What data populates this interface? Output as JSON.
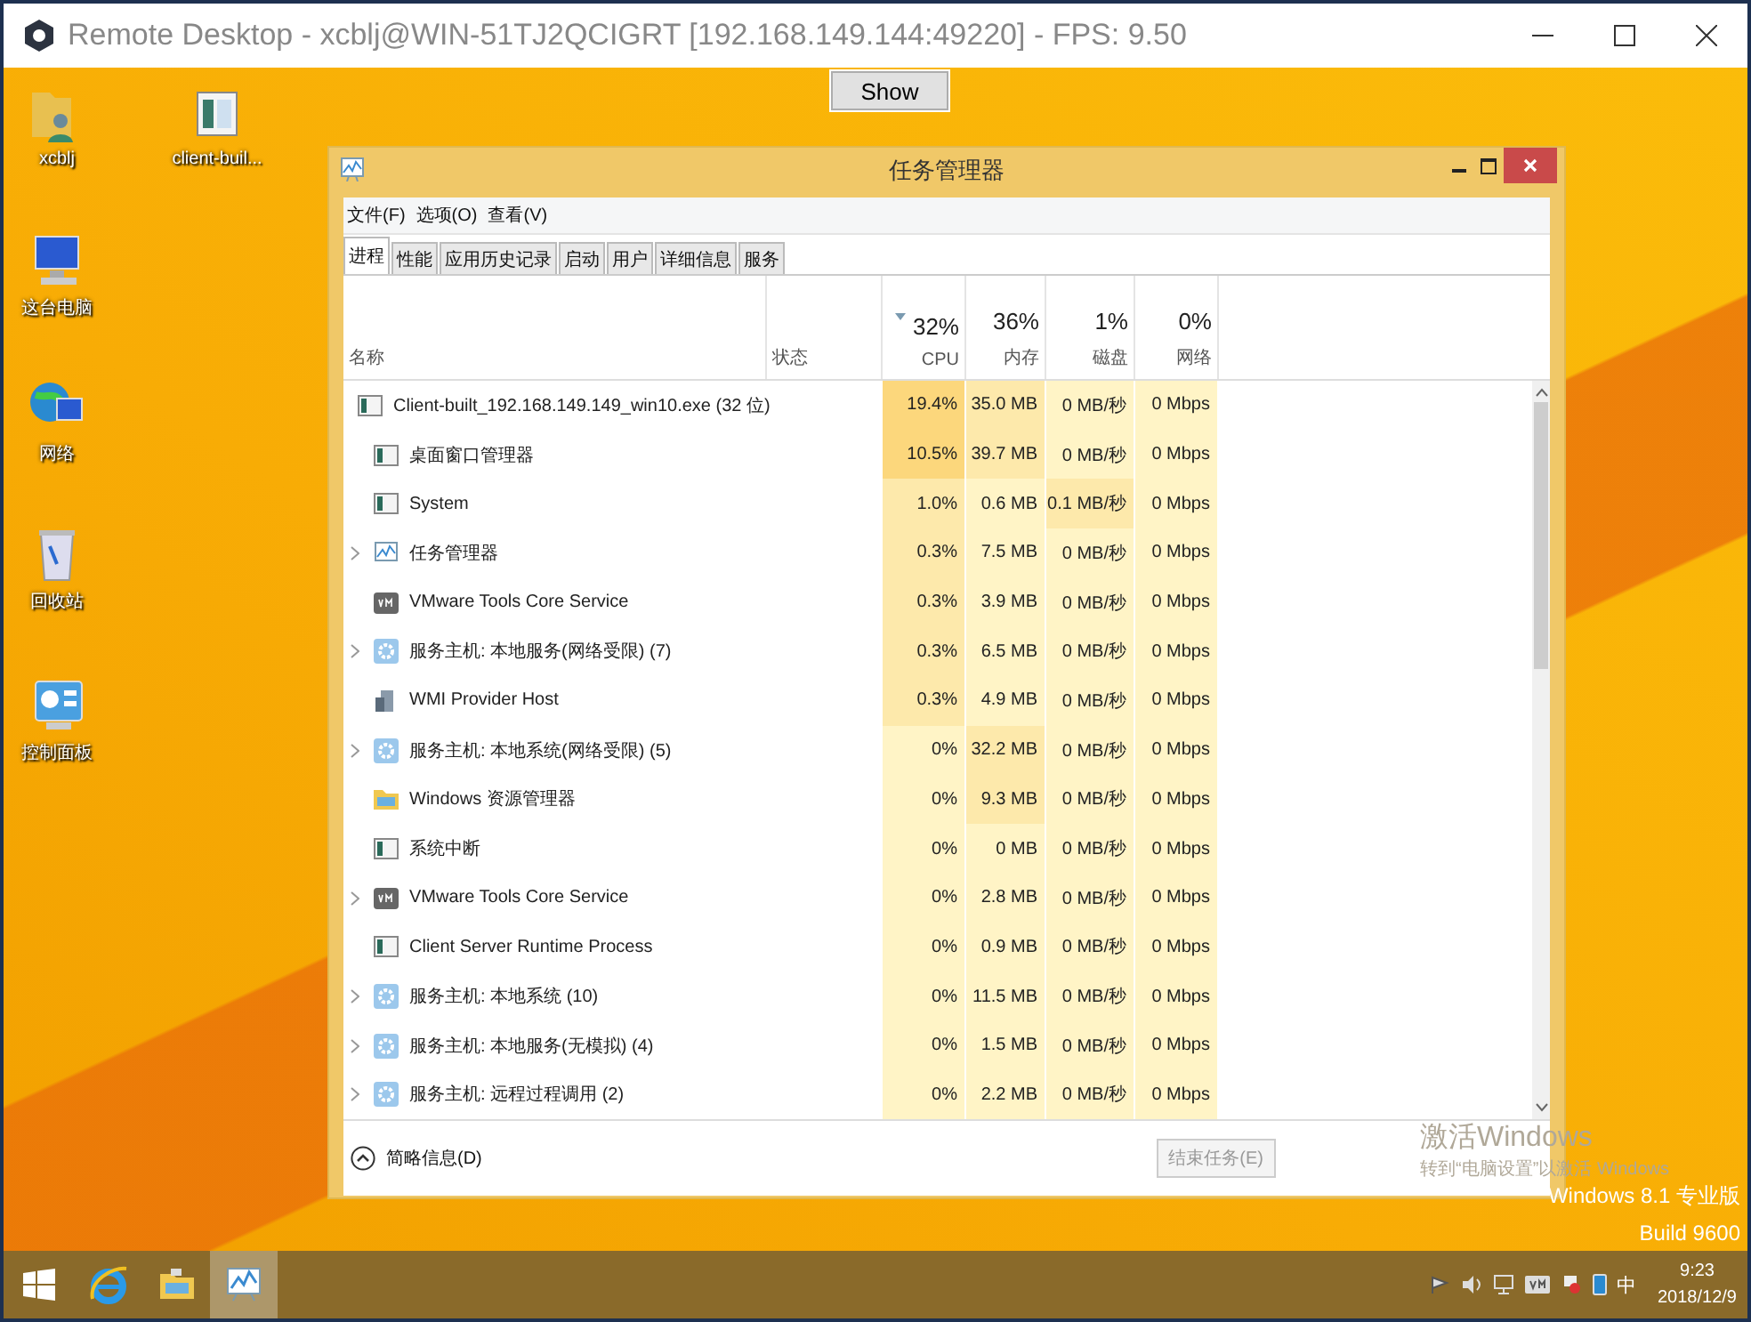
{
  "window": {
    "title": "Remote Desktop - xcblj@WIN-51TJ2QCIGRT [192.168.149.144:49220] - FPS: 9.50"
  },
  "show_button": "Show",
  "desktop_icons": [
    {
      "label": "xcblj",
      "kind": "userfolder"
    },
    {
      "label": "client-buil...",
      "kind": "app"
    },
    {
      "label": "这台电脑",
      "kind": "computer"
    },
    {
      "label": "网络",
      "kind": "network"
    },
    {
      "label": "回收站",
      "kind": "bin"
    },
    {
      "label": "控制面板",
      "kind": "panel"
    }
  ],
  "task_manager": {
    "title": "任务管理器",
    "menu": [
      "文件(F)",
      "选项(O)",
      "查看(V)"
    ],
    "tabs": [
      {
        "label": "进程",
        "selected": true
      },
      {
        "label": "性能",
        "selected": false
      },
      {
        "label": "应用历史记录",
        "selected": false
      },
      {
        "label": "启动",
        "selected": false
      },
      {
        "label": "用户",
        "selected": false
      },
      {
        "label": "详细信息",
        "selected": false
      },
      {
        "label": "服务",
        "selected": false
      }
    ],
    "columns": [
      {
        "label": "名称",
        "kind": "text"
      },
      {
        "label": "状态",
        "kind": "text"
      },
      {
        "label": "CPU",
        "percent": "32%",
        "kind": "metric",
        "sorted": true
      },
      {
        "label": "内存",
        "percent": "36%",
        "kind": "metric",
        "sorted": false
      },
      {
        "label": "磁盘",
        "percent": "1%",
        "kind": "metric",
        "sorted": false
      },
      {
        "label": "网络",
        "percent": "0%",
        "kind": "metric",
        "sorted": false
      }
    ],
    "rows": [
      {
        "kind": "app",
        "expandable": false,
        "cells": [
          {
            "text": "Client-built_192.168.149.149_win10.exe (32 位)"
          },
          {
            "text": ""
          },
          {
            "text": "19.4%",
            "kind": "hot"
          },
          {
            "text": "35.0 MB",
            "kind": "warm"
          },
          {
            "text": "0 MB/秒",
            "kind": "cool"
          },
          {
            "text": "0 Mbps",
            "kind": "cool"
          }
        ]
      },
      {
        "kind": "app",
        "expandable": false,
        "cells": [
          {
            "text": "桌面窗口管理器"
          },
          {
            "text": ""
          },
          {
            "text": "10.5%",
            "kind": "hot"
          },
          {
            "text": "39.7 MB",
            "kind": "warm"
          },
          {
            "text": "0 MB/秒",
            "kind": "cool"
          },
          {
            "text": "0 Mbps",
            "kind": "cool"
          }
        ]
      },
      {
        "kind": "app",
        "expandable": false,
        "cells": [
          {
            "text": "System"
          },
          {
            "text": ""
          },
          {
            "text": "1.0%",
            "kind": "warm"
          },
          {
            "text": "0.6 MB",
            "kind": "cool"
          },
          {
            "text": "0.1 MB/秒",
            "kind": "warm"
          },
          {
            "text": "0 Mbps",
            "kind": "cool"
          }
        ]
      },
      {
        "kind": "chart",
        "expandable": true,
        "cells": [
          {
            "text": "任务管理器"
          },
          {
            "text": ""
          },
          {
            "text": "0.3%",
            "kind": "warm"
          },
          {
            "text": "7.5 MB",
            "kind": "cool"
          },
          {
            "text": "0 MB/秒",
            "kind": "cool"
          },
          {
            "text": "0 Mbps",
            "kind": "cool"
          }
        ]
      },
      {
        "kind": "vm",
        "expandable": false,
        "cells": [
          {
            "text": "VMware Tools Core Service"
          },
          {
            "text": ""
          },
          {
            "text": "0.3%",
            "kind": "warm"
          },
          {
            "text": "3.9 MB",
            "kind": "cool"
          },
          {
            "text": "0 MB/秒",
            "kind": "cool"
          },
          {
            "text": "0 Mbps",
            "kind": "cool"
          }
        ]
      },
      {
        "kind": "gear",
        "expandable": true,
        "cells": [
          {
            "text": "服务主机: 本地服务(网络受限) (7)"
          },
          {
            "text": ""
          },
          {
            "text": "0.3%",
            "kind": "warm"
          },
          {
            "text": "6.5 MB",
            "kind": "cool"
          },
          {
            "text": "0 MB/秒",
            "kind": "cool"
          },
          {
            "text": "0 Mbps",
            "kind": "cool"
          }
        ]
      },
      {
        "kind": "wmi",
        "expandable": false,
        "cells": [
          {
            "text": "WMI Provider Host"
          },
          {
            "text": ""
          },
          {
            "text": "0.3%",
            "kind": "warm"
          },
          {
            "text": "4.9 MB",
            "kind": "cool"
          },
          {
            "text": "0 MB/秒",
            "kind": "cool"
          },
          {
            "text": "0 Mbps",
            "kind": "cool"
          }
        ]
      },
      {
        "kind": "gear",
        "expandable": true,
        "cells": [
          {
            "text": "服务主机: 本地系统(网络受限) (5)"
          },
          {
            "text": ""
          },
          {
            "text": "0%",
            "kind": "cool"
          },
          {
            "text": "32.2 MB",
            "kind": "warm"
          },
          {
            "text": "0 MB/秒",
            "kind": "cool"
          },
          {
            "text": "0 Mbps",
            "kind": "cool"
          }
        ]
      },
      {
        "kind": "folder",
        "expandable": false,
        "cells": [
          {
            "text": "Windows 资源管理器"
          },
          {
            "text": ""
          },
          {
            "text": "0%",
            "kind": "cool"
          },
          {
            "text": "9.3 MB",
            "kind": "warm"
          },
          {
            "text": "0 MB/秒",
            "kind": "cool"
          },
          {
            "text": "0 Mbps",
            "kind": "cool"
          }
        ]
      },
      {
        "kind": "app",
        "expandable": false,
        "cells": [
          {
            "text": "系统中断"
          },
          {
            "text": ""
          },
          {
            "text": "0%",
            "kind": "cool"
          },
          {
            "text": "0 MB",
            "kind": "cool"
          },
          {
            "text": "0 MB/秒",
            "kind": "cool"
          },
          {
            "text": "0 Mbps",
            "kind": "cool"
          }
        ]
      },
      {
        "kind": "vm",
        "expandable": true,
        "cells": [
          {
            "text": "VMware Tools Core Service"
          },
          {
            "text": ""
          },
          {
            "text": "0%",
            "kind": "cool"
          },
          {
            "text": "2.8 MB",
            "kind": "cool"
          },
          {
            "text": "0 MB/秒",
            "kind": "cool"
          },
          {
            "text": "0 Mbps",
            "kind": "cool"
          }
        ]
      },
      {
        "kind": "app",
        "expandable": false,
        "cells": [
          {
            "text": "Client Server Runtime Process"
          },
          {
            "text": ""
          },
          {
            "text": "0%",
            "kind": "cool"
          },
          {
            "text": "0.9 MB",
            "kind": "cool"
          },
          {
            "text": "0 MB/秒",
            "kind": "cool"
          },
          {
            "text": "0 Mbps",
            "kind": "cool"
          }
        ]
      },
      {
        "kind": "gear",
        "expandable": true,
        "cells": [
          {
            "text": "服务主机: 本地系统 (10)"
          },
          {
            "text": ""
          },
          {
            "text": "0%",
            "kind": "cool"
          },
          {
            "text": "11.5 MB",
            "kind": "cool"
          },
          {
            "text": "0 MB/秒",
            "kind": "cool"
          },
          {
            "text": "0 Mbps",
            "kind": "cool"
          }
        ]
      },
      {
        "kind": "gear",
        "expandable": true,
        "cells": [
          {
            "text": "服务主机: 本地服务(无模拟) (4)"
          },
          {
            "text": ""
          },
          {
            "text": "0%",
            "kind": "cool"
          },
          {
            "text": "1.5 MB",
            "kind": "cool"
          },
          {
            "text": "0 MB/秒",
            "kind": "cool"
          },
          {
            "text": "0 Mbps",
            "kind": "cool"
          }
        ]
      },
      {
        "kind": "gear",
        "expandable": true,
        "cells": [
          {
            "text": "服务主机: 远程过程调用 (2)"
          },
          {
            "text": ""
          },
          {
            "text": "0%",
            "kind": "cool"
          },
          {
            "text": "2.2 MB",
            "kind": "cool"
          },
          {
            "text": "0 MB/秒",
            "kind": "cool"
          },
          {
            "text": "0 Mbps",
            "kind": "cool"
          }
        ]
      }
    ],
    "details_link": "简略信息(D)",
    "end_task": {
      "label": "结束任务(E)",
      "disabled": true
    }
  },
  "activation": {
    "title": "激活Windows",
    "hint": "转到“电脑设置”以激活 Windows"
  },
  "edition": [
    "Windows 8.1 专业版",
    "Build 9600"
  ],
  "taskbar": {
    "apps": [
      {
        "kind": "ie",
        "selected": false
      },
      {
        "kind": "explorer",
        "selected": false
      },
      {
        "kind": "taskmgr",
        "selected": true
      }
    ],
    "ime": "中",
    "time": "9:23",
    "date": "2018/12/9"
  }
}
